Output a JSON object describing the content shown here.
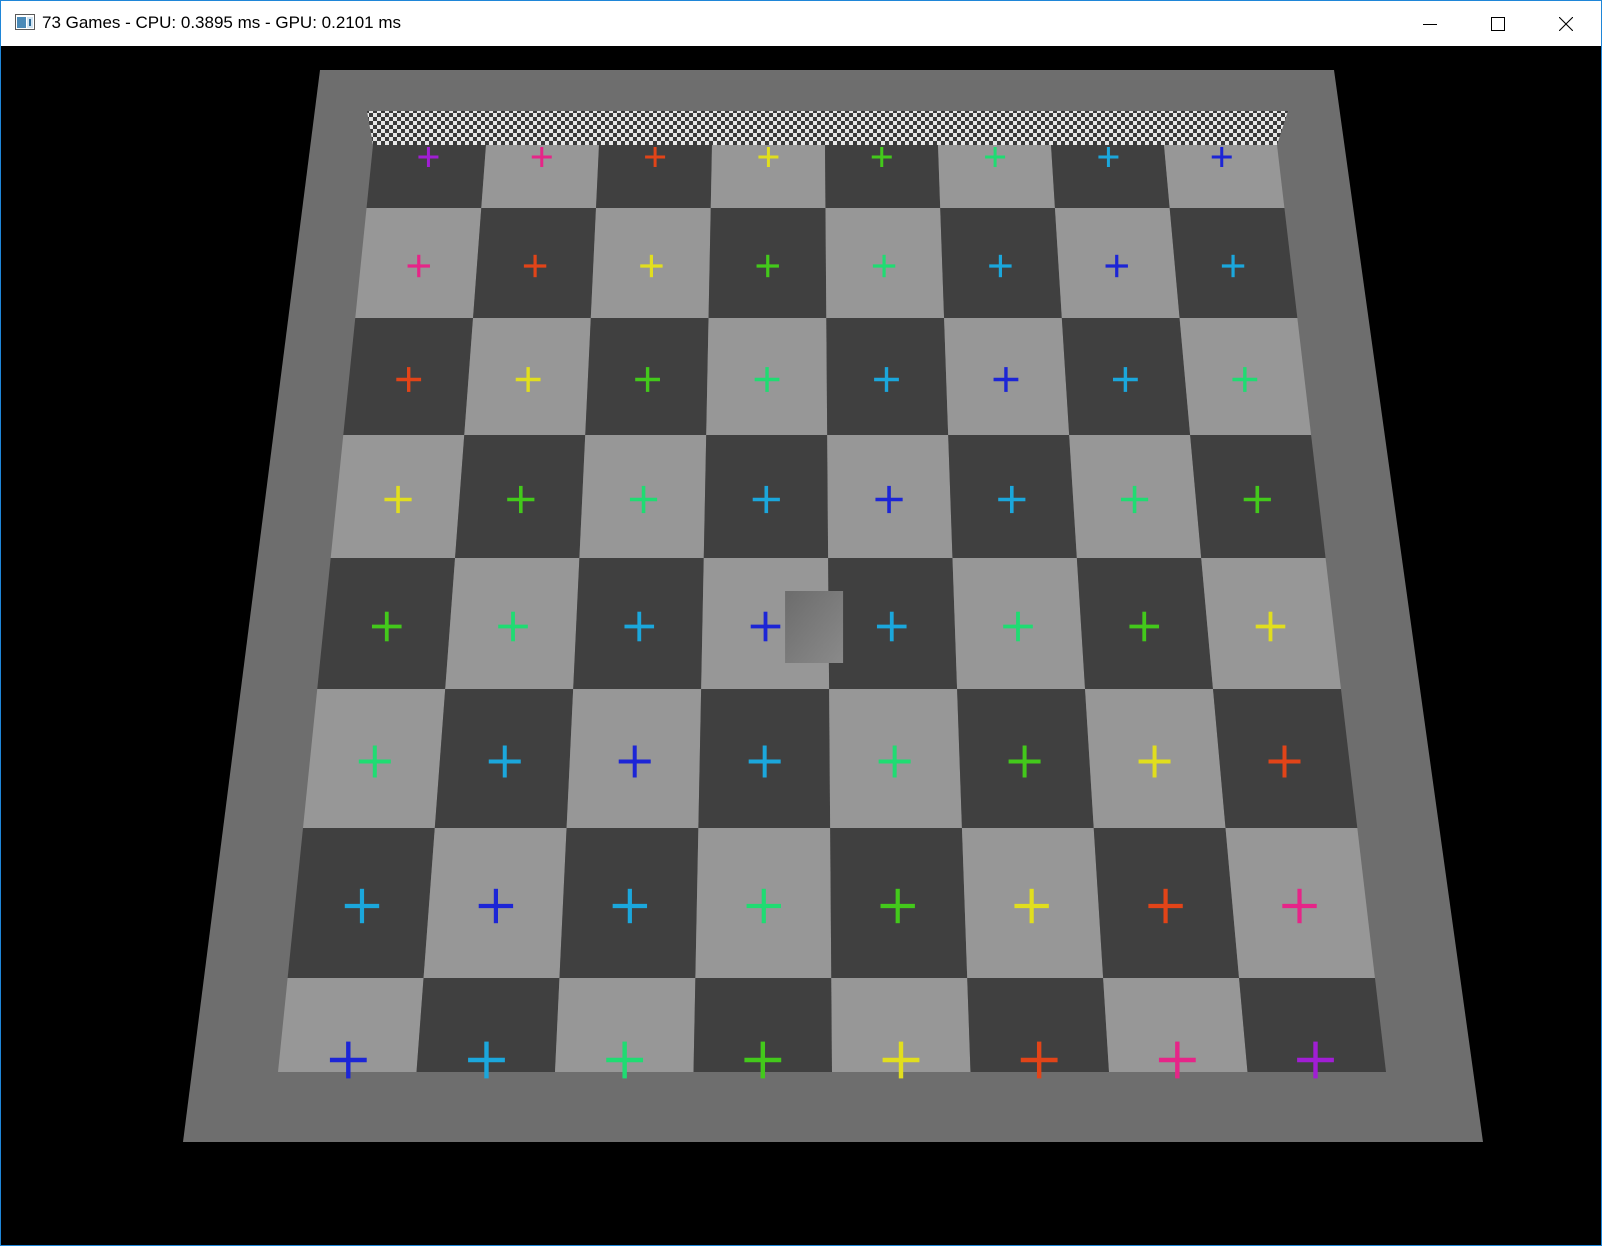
{
  "window": {
    "title": "73 Games - CPU: 0.3895 ms - GPU: 0.2101 ms",
    "icon": "app-window-icon",
    "controls": {
      "minimize_icon": "minimize-icon",
      "maximize_icon": "maximize-icon",
      "close_icon": "close-icon"
    }
  },
  "scene": {
    "board": {
      "rows": 8,
      "cols": 8,
      "light_color": "#979797",
      "dark_color": "#404040",
      "wall_color": "#6e6e6e",
      "back_wall": "checkered"
    },
    "palette": {
      "purple": "#a11ed4",
      "pink": "#e62588",
      "orange": "#e24418",
      "yellow": "#e1de1e",
      "lime": "#43c91b",
      "green": "#1fdc72",
      "cyan": "#1ba7dc",
      "blue": "#1c25d6"
    },
    "marker_colors": [
      [
        "purple",
        "pink",
        "orange",
        "yellow",
        "lime",
        "green",
        "cyan",
        "blue"
      ],
      [
        "pink",
        "orange",
        "yellow",
        "lime",
        "green",
        "cyan",
        "blue",
        "cyan"
      ],
      [
        "orange",
        "yellow",
        "lime",
        "green",
        "cyan",
        "blue",
        "cyan",
        "green"
      ],
      [
        "yellow",
        "lime",
        "green",
        "cyan",
        "blue",
        "cyan",
        "green",
        "lime"
      ],
      [
        "lime",
        "green",
        "cyan",
        "blue",
        "cyan",
        "green",
        "lime",
        "yellow"
      ],
      [
        "green",
        "cyan",
        "blue",
        "cyan",
        "green",
        "lime",
        "yellow",
        "orange"
      ],
      [
        "cyan",
        "blue",
        "cyan",
        "green",
        "lime",
        "yellow",
        "orange",
        "pink"
      ],
      [
        "blue",
        "cyan",
        "green",
        "lime",
        "yellow",
        "orange",
        "pink",
        "purple"
      ]
    ],
    "player_cube": {
      "row": 4,
      "col": 3
    }
  }
}
